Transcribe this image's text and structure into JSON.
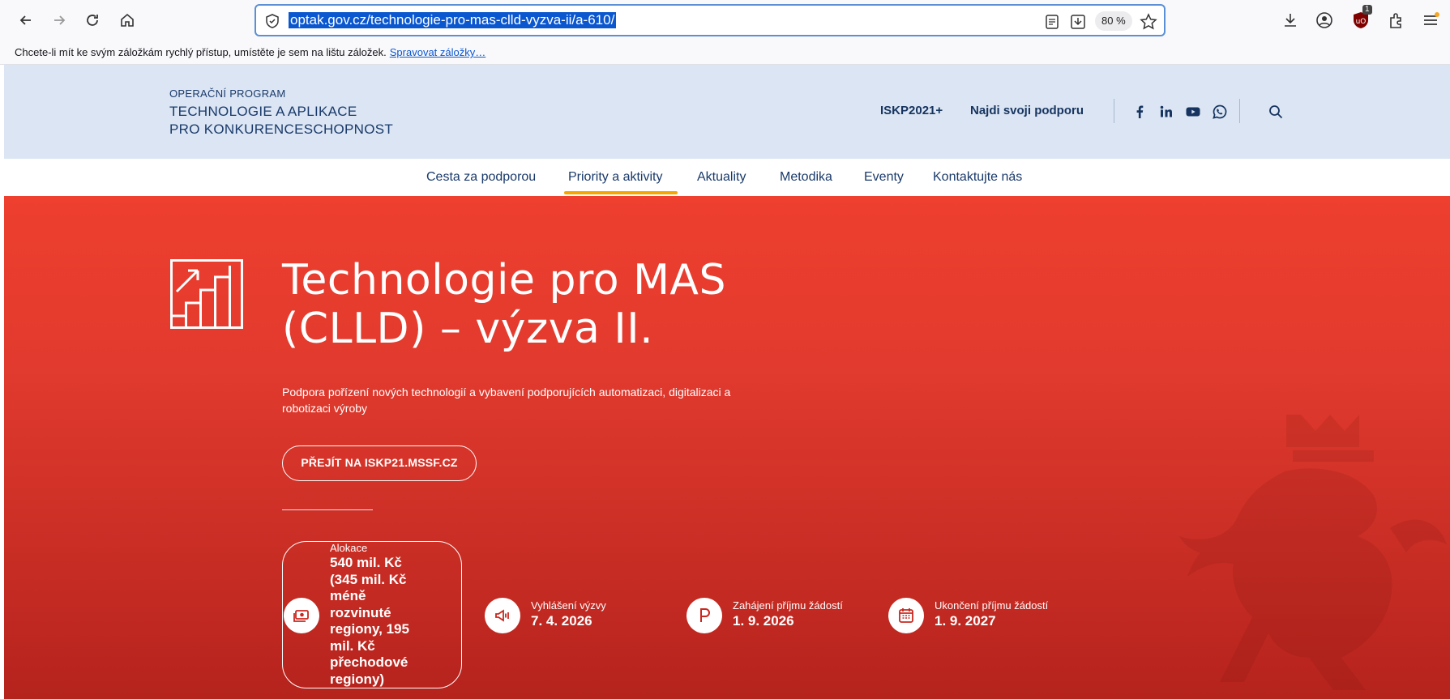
{
  "browser": {
    "url": "optak.gov.cz/technologie-pro-mas-clld-vyzva-ii/a-610/",
    "zoom": "80 %",
    "extension_badge": "1",
    "bookmarks_message": "Chcete-li mít ke svým záložkám rychlý přístup, umístěte je sem na lištu záložek.",
    "bookmarks_manage_link": "Spravovat záložky…"
  },
  "header": {
    "logo_line1": "OPERAČNÍ PROGRAM",
    "logo_line2": "TECHNOLOGIE A APLIKACE",
    "logo_line3": "PRO KONKURENCESCHOPNOST",
    "link_iskp": "ISKP2021+",
    "link_support": "Najdi svoji podporu",
    "social_icons": [
      "facebook-icon",
      "linkedin-icon",
      "youtube-icon",
      "whatsapp-icon"
    ]
  },
  "nav": {
    "items": [
      "Cesta za podporou",
      "Priority a aktivity",
      "Aktuality",
      "Metodika",
      "Eventy",
      "Kontaktujte nás"
    ],
    "active_index": 1,
    "active_color": "#f7a600"
  },
  "hero": {
    "title_line1": "Technologie pro MAS",
    "title_line2": "(CLLD) – výzva II.",
    "description": "Podpora pořízení nových technologií a vybavení podporujících automatizaci, digitalizaci a robotizaci výroby",
    "button_label": "PŘEJÍT NA ISKP21.MSSF.CZ",
    "background_color": "#e13a2e"
  },
  "stats": {
    "allocation": {
      "label": "Alokace",
      "value": "540 mil. Kč (345 mil. Kč méně rozvinuté regiony, 195 mil. Kč přechodové regiony)"
    },
    "announcement": {
      "label": "Vyhlášení výzvy",
      "value": "7. 4. 2026"
    },
    "start": {
      "label": "Zahájení příjmu žádostí",
      "value": "1. 9. 2026"
    },
    "end": {
      "label": "Ukončení příjmu žádostí",
      "value": "1. 9. 2027"
    }
  }
}
